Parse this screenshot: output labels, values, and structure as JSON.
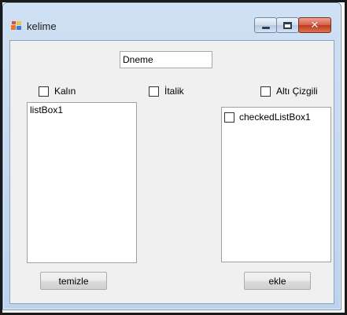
{
  "window": {
    "title": "kelime"
  },
  "form": {
    "textbox_value": "Dneme",
    "checkboxes": [
      {
        "label": "Kalın",
        "checked": false
      },
      {
        "label": "İtalik",
        "checked": false
      },
      {
        "label": "Altı Çizgili",
        "checked": false
      }
    ],
    "listbox": {
      "items": [
        "listBox1"
      ]
    },
    "checked_listbox": {
      "items": [
        {
          "label": "checkedListBox1",
          "checked": false
        }
      ]
    },
    "buttons": {
      "clear_label": "temizle",
      "add_label": "ekle"
    }
  },
  "icons": {
    "app": "winforms-app-icon",
    "minimize": "minimize-icon",
    "maximize": "maximize-icon",
    "close": "close-icon"
  },
  "colors": {
    "frame": "#bcd3ee",
    "client": "#f0f0f0",
    "close_button": "#c0391f"
  }
}
